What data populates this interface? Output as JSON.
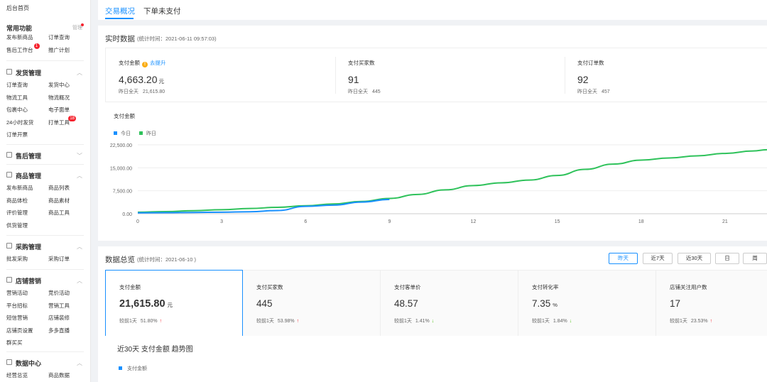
{
  "sidebar": {
    "home": "后台首页",
    "common": {
      "title": "常用功能",
      "manage": "管理",
      "items": [
        {
          "label": "发布新商品"
        },
        {
          "label": "订单查询"
        },
        {
          "label": "售后工作台",
          "badge": "1"
        },
        {
          "label": "推广计划"
        }
      ]
    },
    "sections": [
      {
        "title": "发货管理",
        "expanded": true,
        "items": [
          {
            "label": "订单查询"
          },
          {
            "label": "发货中心"
          },
          {
            "label": "物流工具"
          },
          {
            "label": "物流概况"
          },
          {
            "label": "包裹中心"
          },
          {
            "label": "电子面单"
          },
          {
            "label": "24小时发货"
          },
          {
            "label": "打单工具",
            "badge": "18"
          },
          {
            "label": "订单开票"
          }
        ]
      },
      {
        "title": "售后管理",
        "expanded": false,
        "items": []
      },
      {
        "title": "商品管理",
        "expanded": true,
        "items": [
          {
            "label": "发布新商品"
          },
          {
            "label": "商品列表"
          },
          {
            "label": "商品体检"
          },
          {
            "label": "商品素材"
          },
          {
            "label": "评价管理"
          },
          {
            "label": "商品工具"
          },
          {
            "label": "供货管理"
          }
        ]
      },
      {
        "title": "采购管理",
        "expanded": true,
        "items": [
          {
            "label": "批发采购"
          },
          {
            "label": "采购订单"
          }
        ]
      },
      {
        "title": "店铺营销",
        "expanded": true,
        "items": [
          {
            "label": "营销活动"
          },
          {
            "label": "竞价活动"
          },
          {
            "label": "平台招标"
          },
          {
            "label": "营销工具"
          },
          {
            "label": "短信营销"
          },
          {
            "label": "店铺装修"
          },
          {
            "label": "店铺页设置"
          },
          {
            "label": "多多直播"
          },
          {
            "label": "群买买"
          }
        ]
      },
      {
        "title": "数据中心",
        "expanded": true,
        "items": [
          {
            "label": "经营总览"
          },
          {
            "label": "商品数据"
          }
        ]
      }
    ]
  },
  "tabs": [
    {
      "label": "交易概况",
      "active": true
    },
    {
      "label": "下单未支付",
      "active": false
    }
  ],
  "realtime": {
    "title": "实时数据",
    "stat_time": "(统计时间：2021-06-11 09:57:03)",
    "metrics": [
      {
        "label": "支付金额",
        "warn": "!",
        "link": "去提升",
        "value": "4,663.20",
        "unit": "元",
        "yesterday_label": "昨日全天",
        "yesterday_value": "21,615.80"
      },
      {
        "label": "支付买家数",
        "value": "91",
        "unit": "",
        "yesterday_label": "昨日全天",
        "yesterday_value": "445"
      },
      {
        "label": "支付订单数",
        "value": "92",
        "unit": "",
        "yesterday_label": "昨日全天",
        "yesterday_value": "457"
      }
    ],
    "chart_title": "支付金额",
    "legend": [
      {
        "label": "今日",
        "color": "#1890ff"
      },
      {
        "label": "昨日",
        "color": "#2fc25b"
      }
    ]
  },
  "chart_data": {
    "type": "line",
    "title": "支付金额",
    "x_ticks": [
      "0",
      "3",
      "6",
      "9",
      "12",
      "15",
      "18",
      "21"
    ],
    "y_ticks": [
      "0.00",
      "7,500.00",
      "15,000.00",
      "22,500.00"
    ],
    "xlim": [
      0,
      22.5
    ],
    "ylim": [
      0,
      22500
    ],
    "series": [
      {
        "name": "今日",
        "color": "#1890ff",
        "x": [
          0,
          1,
          2,
          3,
          4,
          5,
          6,
          7,
          8,
          9
        ],
        "y": [
          300,
          350,
          420,
          500,
          650,
          1050,
          2400,
          2800,
          3800,
          4663.2
        ]
      },
      {
        "name": "昨日",
        "color": "#2fc25b",
        "x": [
          0,
          1,
          2,
          3,
          4,
          5,
          6,
          7,
          8,
          9,
          10,
          11,
          12,
          13,
          14,
          15,
          16,
          17,
          18,
          19,
          20,
          21,
          22,
          22.5
        ],
        "y": [
          500,
          700,
          1000,
          1300,
          1700,
          2100,
          2600,
          3200,
          4000,
          5000,
          6300,
          7800,
          9200,
          10100,
          11000,
          12500,
          14500,
          16200,
          17500,
          18200,
          18900,
          19700,
          20500,
          20900
        ]
      }
    ]
  },
  "overview": {
    "title": "数据总览",
    "stat_time": "(统计时间：2021-06-10 )",
    "buttons": [
      {
        "label": "昨天",
        "active": true
      },
      {
        "label": "近7天",
        "active": false
      },
      {
        "label": "近30天",
        "active": false
      },
      {
        "label": "日",
        "active": false
      },
      {
        "label": "周",
        "active": false
      }
    ],
    "metrics": [
      {
        "label": "支付金额",
        "value": "21,615.80",
        "unit": "元",
        "cmp_label": "较前1天",
        "cmp_value": "51.80%",
        "trend": "up",
        "active": true
      },
      {
        "label": "支付买家数",
        "value": "445",
        "unit": "",
        "cmp_label": "较前1天",
        "cmp_value": "53.98%",
        "trend": "up",
        "active": false
      },
      {
        "label": "支付客单价",
        "value": "48.57",
        "unit": "",
        "cmp_label": "较前1天",
        "cmp_value": "1.41%",
        "trend": "down",
        "active": false
      },
      {
        "label": "支付转化率",
        "value": "7.35",
        "unit": "%",
        "cmp_label": "较前1天",
        "cmp_value": "1.84%",
        "trend": "down",
        "active": false
      },
      {
        "label": "店铺关注用户数",
        "value": "17",
        "unit": "",
        "cmp_label": "较前1天",
        "cmp_value": "23.53%",
        "trend": "up",
        "active": false
      }
    ],
    "trend_title": "近30天 支付金额 趋势图",
    "trend_legend": "支付金额"
  }
}
